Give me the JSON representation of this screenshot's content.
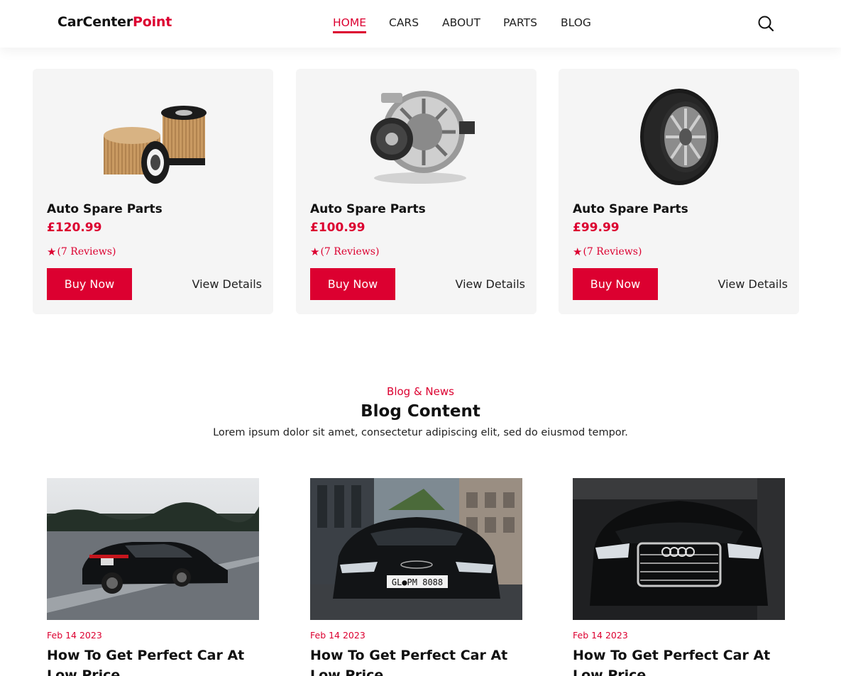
{
  "header": {
    "logo_part1": "CarCenter",
    "logo_part2": "Point",
    "nav": [
      {
        "label": "HOME",
        "active": true
      },
      {
        "label": "CARS",
        "active": false
      },
      {
        "label": "ABOUT",
        "active": false
      },
      {
        "label": "PARTS",
        "active": false
      },
      {
        "label": "BLOG",
        "active": false
      }
    ],
    "search_icon": "search-icon"
  },
  "products": [
    {
      "image": "oil-filter",
      "title": "Auto Spare Parts",
      "price": "£120.99",
      "reviews": "(7 Reviews)",
      "buy_label": "Buy Now",
      "details_label": "View Details"
    },
    {
      "image": "alternator",
      "title": "Auto Spare Parts",
      "price": "£100.99",
      "reviews": "(7 Reviews)",
      "buy_label": "Buy Now",
      "details_label": "View Details"
    },
    {
      "image": "tire",
      "title": "Auto Spare Parts",
      "price": "£99.99",
      "reviews": "(7 Reviews)",
      "buy_label": "Buy Now",
      "details_label": "View Details"
    }
  ],
  "blog": {
    "subtitle": "Blog & News",
    "title": "Blog Content",
    "description": "Lorem ipsum dolor sit amet, consectetur adipiscing elit, sed do eiusmod tempor.",
    "posts": [
      {
        "image": "black-sports-car-on-highway",
        "date": "Feb 14 2023",
        "title": "How To Get Perfect Car At Low Price"
      },
      {
        "image": "black-supercar-front",
        "date": "Feb 14 2023",
        "title": "How To Get Perfect Car At Low Price"
      },
      {
        "image": "black-sedan-front-dark",
        "date": "Feb 14 2023",
        "title": "How To Get Perfect Car At Low Price"
      }
    ]
  },
  "colors": {
    "accent": "#dc0030",
    "card_bg": "#f5f5f5",
    "text": "#111111"
  }
}
